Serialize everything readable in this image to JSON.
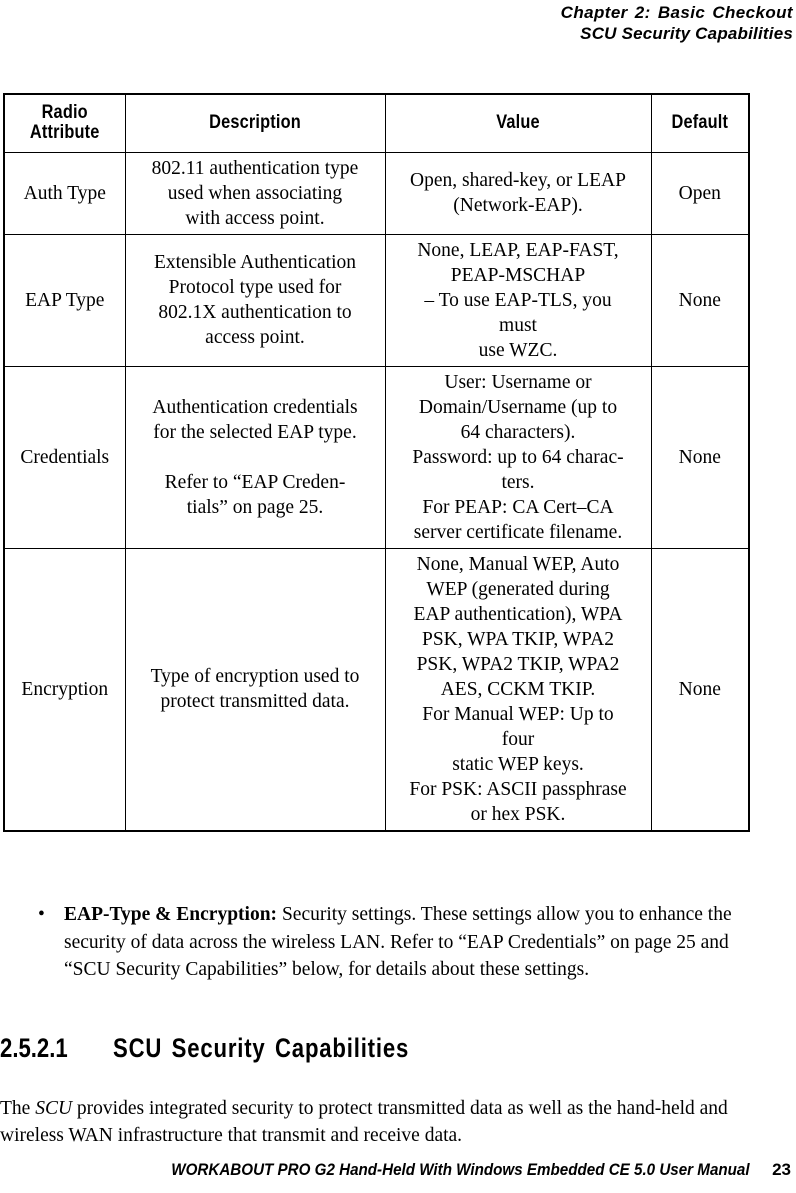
{
  "header": {
    "chapter": "Chapter  2:  Basic Checkout",
    "section": "SCU Security Capabilities"
  },
  "table": {
    "columns": [
      "Radio\nAttribute",
      "Description",
      "Value",
      "Default"
    ],
    "rows": [
      {
        "attribute": "Auth Type",
        "description": "802.11 authentication type\nused when associating\nwith access point.",
        "value": "Open, shared-key, or LEAP\n(Network-EAP).",
        "default": "Open"
      },
      {
        "attribute": "EAP Type",
        "description": "Extensible Authentication\nProtocol type used for\n802.1X authentication to\naccess point.",
        "value": "None, LEAP, EAP-FAST,\nPEAP-MSCHAP\n– To use EAP-TLS, you\nmust\nuse WZC.",
        "default": "None"
      },
      {
        "attribute": "Credentials",
        "description": "Authentication credentials\nfor the selected EAP type.\n\nRefer to “EAP Creden-\ntials” on page 25.",
        "value": "User: Username or\nDomain/Username (up to\n64 characters).\nPassword: up to 64 charac-\nters.\nFor PEAP: CA Cert–CA\nserver certificate filename.",
        "default": "None"
      },
      {
        "attribute": "Encryption",
        "description": "Type of encryption used to\nprotect transmitted data.",
        "value": "None, Manual WEP, Auto\nWEP (generated during\nEAP authentication), WPA\nPSK, WPA TKIP, WPA2\nPSK, WPA2 TKIP, WPA2\nAES, CCKM TKIP.\nFor Manual WEP: Up to\nfour\nstatic WEP keys.\nFor PSK: ASCII passphrase\nor hex PSK.",
        "default": "None"
      }
    ]
  },
  "bullet": {
    "marker": "•",
    "lead_in": "EAP-Type & Encryption:",
    "body": " Security settings. These settings allow you to enhance the security of data across the wireless LAN. Refer to “EAP Credentials” on page 25 and “SCU Security Capabilities” below, for details about these settings."
  },
  "section_heading": {
    "number": "2.5.2.1",
    "title": "SCU  Security  Capabilities"
  },
  "body_paragraph": {
    "part1": "The ",
    "emphasis": "SCU",
    "part2": " provides integrated security to protect transmitted data as well as the hand-held and wireless WAN infrastructure that transmit and receive data."
  },
  "footer": {
    "manual_title": "WORKABOUT PRO G2 Hand-Held With Windows Embedded CE 5.0 User Manual",
    "page_number": "23"
  }
}
